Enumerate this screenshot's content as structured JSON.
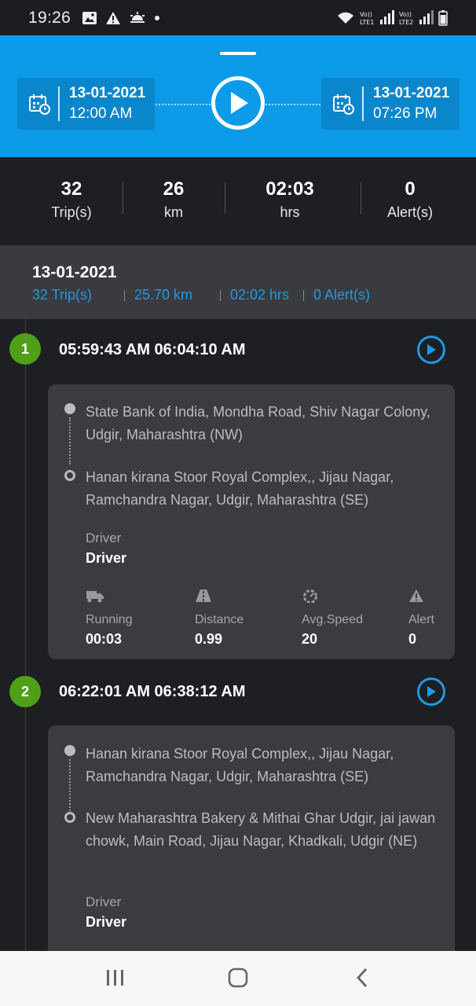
{
  "status_bar": {
    "time": "19:26"
  },
  "header": {
    "start": {
      "date": "13-01-2021",
      "time": "12:00 AM"
    },
    "end": {
      "date": "13-01-2021",
      "time": "07:26 PM"
    }
  },
  "summary": [
    {
      "value": "32",
      "label": "Trip(s)"
    },
    {
      "value": "26",
      "label": "km"
    },
    {
      "value": "02:03",
      "label": "hrs"
    },
    {
      "value": "0",
      "label": "Alert(s)"
    }
  ],
  "day": {
    "date": "13-01-2021",
    "trips": "32 Trip(s)",
    "distance": "25.70 km",
    "duration": "02:02 hrs",
    "alerts": "0 Alert(s)"
  },
  "trips": [
    {
      "number": "1",
      "time_range": "05:59:43 AM 06:04:10 AM",
      "from": "State Bank of India, Mondha Road, Shiv Nagar Colony, Udgir, Maharashtra (NW)",
      "to": "Hanan kirana Stoor Royal Complex,, Jijau Nagar, Ramchandra Nagar, Udgir, Maharashtra (SE)",
      "driver_label": "Driver",
      "driver_name": "Driver",
      "stats": [
        {
          "label": "Running",
          "value": "00:03"
        },
        {
          "label": "Distance",
          "value": "0.99"
        },
        {
          "label": "Avg.Speed",
          "value": "20"
        },
        {
          "label": "Alert",
          "value": "0"
        }
      ]
    },
    {
      "number": "2",
      "time_range": "06:22:01 AM 06:38:12 AM",
      "from": "Hanan kirana Stoor Royal Complex,, Jijau Nagar, Ramchandra Nagar, Udgir, Maharashtra (SE)",
      "to": "New Maharashtra Bakery & Mithai Ghar Udgir, jai jawan chowk, Main Road, Jijau Nagar, Khadkali, Udgir (NE)",
      "driver_label": "Driver",
      "driver_name": "Driver"
    }
  ],
  "colors": {
    "header": "#0b9be8",
    "accent": "#1e98e6",
    "trip_badge": "#4fa018",
    "background": "#1e1f23",
    "card": "#3b3c40"
  }
}
